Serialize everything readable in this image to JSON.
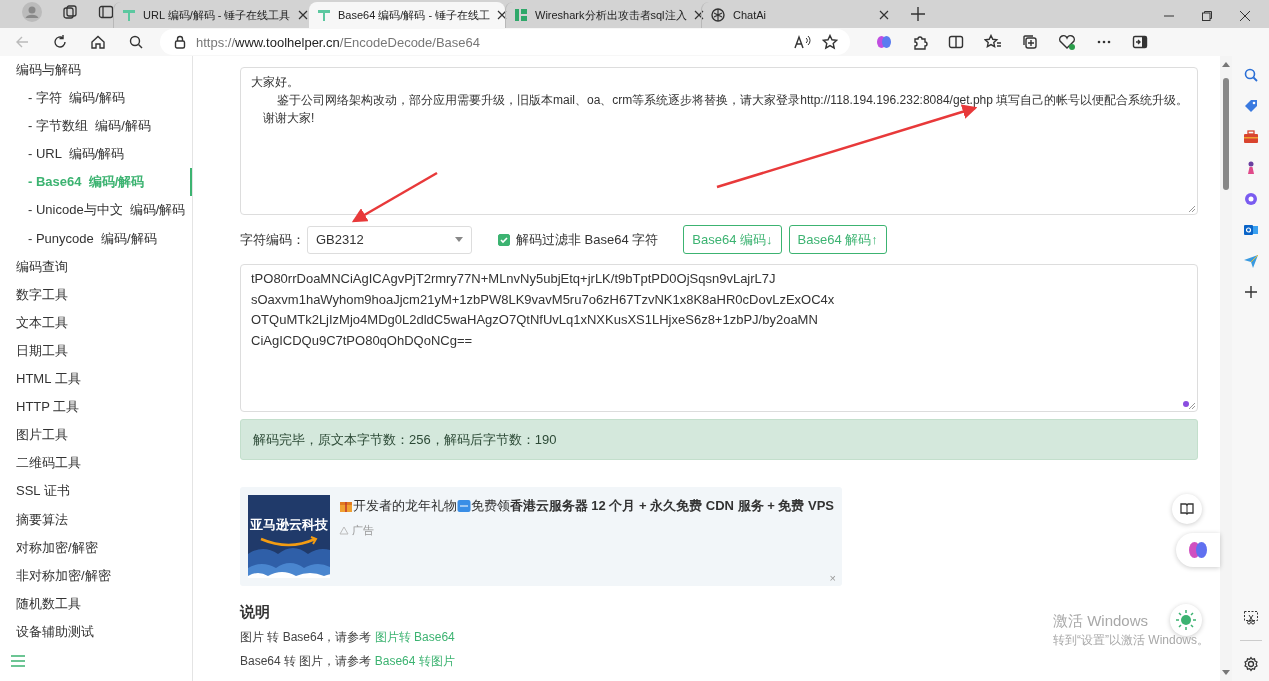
{
  "browser": {
    "tabs": [
      {
        "kind": "hammer",
        "title": "URL 编码/解码 - 锤子在线工具",
        "selected": false
      },
      {
        "kind": "hammer",
        "title": "Base64 编码/解码 - 锤子在线工",
        "selected": true
      },
      {
        "kind": "doc",
        "title": "Wireshark分析出攻击者sql注入",
        "selected": false
      },
      {
        "kind": "chat",
        "title": "ChatAi",
        "selected": false
      }
    ],
    "url": {
      "scheme": "https://",
      "domain": "www.toolhelper.cn",
      "path": "/EncodeDecode/Base64"
    }
  },
  "sidebar": {
    "items": [
      {
        "label": "编码与解码",
        "children": [
          {
            "label": "- 字符  编码/解码",
            "selected": false
          },
          {
            "label": "- 字节数组  编码/解码",
            "selected": false
          },
          {
            "label": "- URL  编码/解码",
            "selected": false
          },
          {
            "label": "- Base64  编码/解码",
            "selected": true
          },
          {
            "label": "- Unicode与中文  编码/解码",
            "selected": false
          },
          {
            "label": "- Punycode  编码/解码",
            "selected": false
          }
        ]
      },
      {
        "label": "编码查询"
      },
      {
        "label": "数字工具"
      },
      {
        "label": "文本工具"
      },
      {
        "label": "日期工具"
      },
      {
        "label": "HTML 工具"
      },
      {
        "label": "HTTP 工具"
      },
      {
        "label": "图片工具"
      },
      {
        "label": "二维码工具"
      },
      {
        "label": "SSL 证书"
      },
      {
        "label": "摘要算法"
      },
      {
        "label": "对称加密/解密"
      },
      {
        "label": "非对称加密/解密"
      },
      {
        "label": "随机数工具"
      },
      {
        "label": "设备辅助测试"
      }
    ]
  },
  "main": {
    "input_lines": [
      "大家好。",
      "鉴于公司网络架构改动，部分应用需要升级，旧版本mail、oa、crm等系统逐步将替换，请大家登录http://118.194.196.232:8084/get.php 填写自己的帐号以便配合系统升级。",
      "谢谢大家!"
    ],
    "encoding_label": "字符编码：",
    "encoding_value": "GB2312",
    "filter_checkbox": {
      "label": "解码过滤非 Base64 字符",
      "checked": true
    },
    "buttons": [
      "Base64 编码↓",
      "Base64 解码↑"
    ],
    "output_text": "tPO80rrDoaMNCiAgICAgvPjT2rmry77N+MLnvNy5ubjEtq+jrLK/t9bTptPD0OjSqsn9vLajrL7J\nsOaxvm1haWyhom9hoaJjcm21yM+1zbPW8LK9vavM5ru7o6zH67TzvNK1x8K8aHR0cDovLzExOC4x\nOTQuMTk2LjIzMjo4MDg0L2dldC5waHAgzO7QtNfUvLq1xNXKusXS1LHjxeS6z8+1zbPJ/by2oaMN\nCiAgICDQu9C7tPO80qOhDQoNCg==",
    "status": "解码完毕，原文本字节数：256，解码后字节数：190",
    "ad": {
      "image_text": "亚马逊云科技",
      "title_lead": "开发者的龙年礼物",
      "title_main": "免费领**香港云服务器 12 个月 + 永久免费 CDN 服务 + 免费 VPS**",
      "label": "广告",
      "close": "×"
    },
    "notes": {
      "heading": "说明",
      "lines": [
        {
          "text": "图片 转 Base64，请参考 ",
          "link": "图片转 Base64"
        },
        {
          "text": "Base64 转 图片，请参考 ",
          "link": "Base64 转图片"
        }
      ]
    }
  },
  "os_notice": {
    "title": "激活 Windows",
    "subtitle": "转到“设置”以激活 Windows。"
  }
}
